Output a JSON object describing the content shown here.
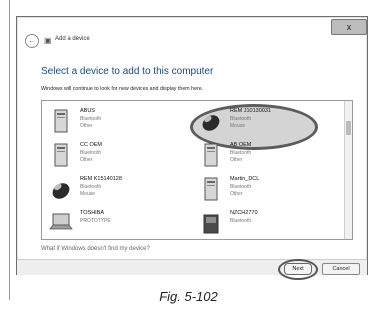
{
  "window": {
    "title": "Add a device",
    "close_label": "x",
    "heading": "Select a device to add to this computer",
    "description": "Windows will continue to look for new devices and display them here.",
    "help_link": "What if Windows doesn't find my device?",
    "next_label": "Next",
    "cancel_label": "Cancel"
  },
  "devices": [
    {
      "name": "ABUS",
      "type": "Bluetooth",
      "category": "Other",
      "icon": "device-tower-icon"
    },
    {
      "name": "REM J10130031",
      "type": "Bluetooth",
      "category": "Mouse",
      "icon": "mouse-icon"
    },
    {
      "name": "CC OEM",
      "type": "Bluetooth",
      "category": "Other",
      "icon": "device-tower-icon"
    },
    {
      "name": "AB OEM",
      "type": "Bluetooth",
      "category": "Other",
      "icon": "device-tower-icon"
    },
    {
      "name": "REM K15140128",
      "type": "Bluetooth",
      "category": "Mouse",
      "icon": "mouse-icon"
    },
    {
      "name": "Martin_DCL",
      "type": "Bluetooth",
      "category": "Other",
      "icon": "device-tower-icon"
    },
    {
      "name": "TOSHIBA",
      "type": "PROTOTYPE",
      "category": "",
      "icon": "laptop-icon"
    },
    {
      "name": "NZCH2770",
      "type": "Bluetooth",
      "category": "",
      "icon": "device-generic-icon"
    }
  ],
  "caption": "Fig. 5-102"
}
